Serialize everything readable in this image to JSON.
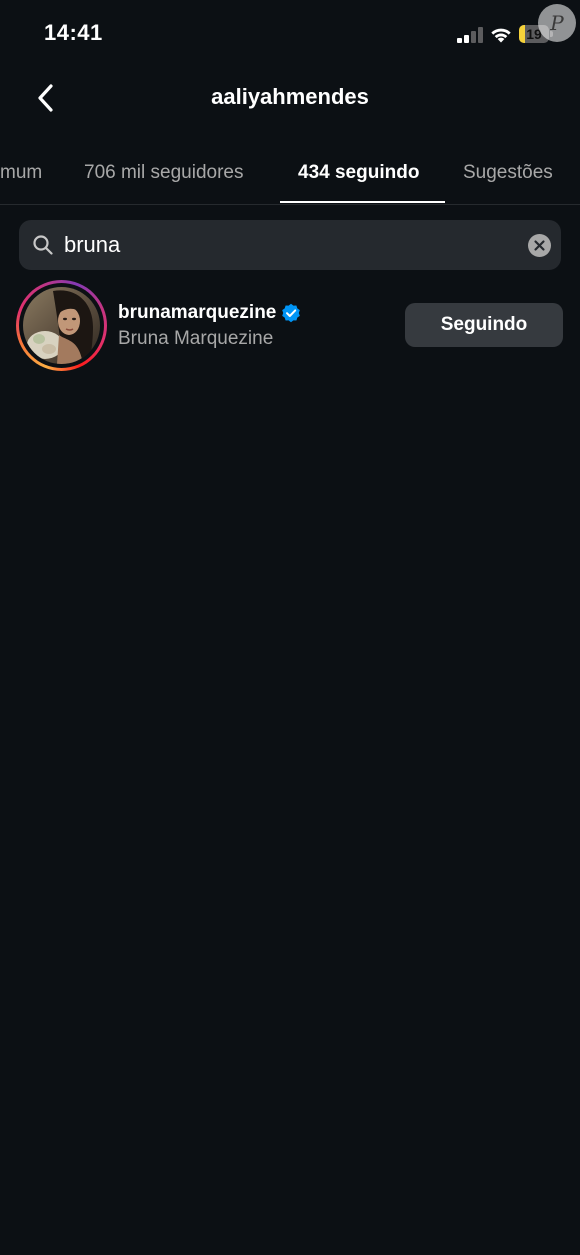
{
  "status_bar": {
    "time": "14:41",
    "battery_level": "19",
    "battery_fraction": 0.19
  },
  "watermark": {
    "letter": "P"
  },
  "header": {
    "title": "aaliyahmendes",
    "back_icon": "chevron-left-icon"
  },
  "tabs": [
    {
      "label": "mum",
      "active": false
    },
    {
      "label": "706 mil seguidores",
      "active": false
    },
    {
      "label": "434 seguindo",
      "active": true
    },
    {
      "label": "Sugestões",
      "active": false
    }
  ],
  "search": {
    "value": "bruna",
    "icon": "search-icon",
    "clear_icon": "clear-icon"
  },
  "results": [
    {
      "username": "brunamarquezine",
      "full_name": "Bruna Marquezine",
      "verified": true,
      "button_label": "Seguindo",
      "ring_colors": [
        "#fcaf45",
        "#f77737",
        "#e1306c",
        "#c13584",
        "#833ab4"
      ]
    }
  ],
  "colors": {
    "background": "#0c1014",
    "search_bg": "#25292e",
    "button_bg": "#363a3f",
    "secondary_text": "#a8a8a8",
    "verified_blue": "#0095f6",
    "battery_yellow": "#f5d23a"
  }
}
